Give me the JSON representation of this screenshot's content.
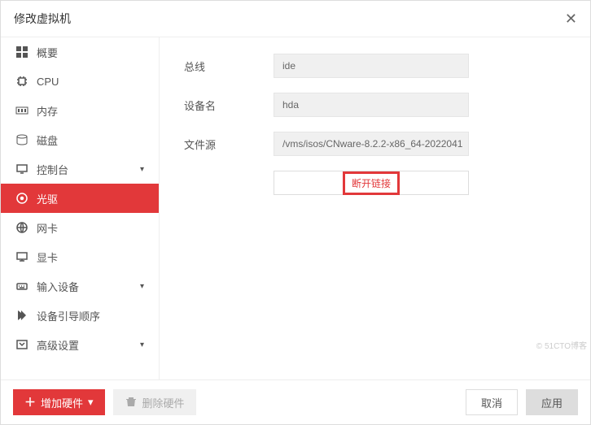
{
  "header": {
    "title": "修改虚拟机"
  },
  "sidebar": {
    "items": [
      {
        "label": "概要",
        "icon": "grid"
      },
      {
        "label": "CPU",
        "icon": "cpu"
      },
      {
        "label": "内存",
        "icon": "memory"
      },
      {
        "label": "磁盘",
        "icon": "disk"
      },
      {
        "label": "控制台",
        "icon": "console",
        "expandable": true
      },
      {
        "label": "光驱",
        "icon": "cdrom",
        "active": true
      },
      {
        "label": "网卡",
        "icon": "network"
      },
      {
        "label": "显卡",
        "icon": "display"
      },
      {
        "label": "输入设备",
        "icon": "input",
        "expandable": true
      },
      {
        "label": "设备引导顺序",
        "icon": "boot"
      },
      {
        "label": "高级设置",
        "icon": "advanced",
        "expandable": true
      }
    ]
  },
  "form": {
    "bus": {
      "label": "总线",
      "value": "ide"
    },
    "device": {
      "label": "设备名",
      "value": "hda"
    },
    "source": {
      "label": "文件源",
      "value": "/vms/isos/CNware-8.2.2-x86_64-2022041"
    },
    "disconnect_label": "断开链接"
  },
  "footer": {
    "add_hardware": "增加硬件",
    "delete_hardware": "删除硬件",
    "cancel": "取消",
    "apply": "应用"
  },
  "watermark": "© 51CTO博客"
}
